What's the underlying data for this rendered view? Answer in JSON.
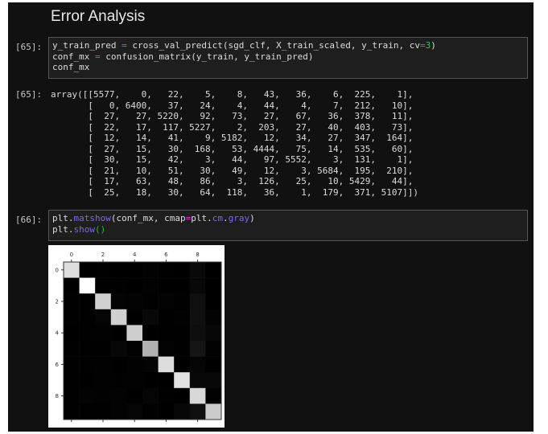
{
  "title": "Error Analysis",
  "cells": [
    {
      "prompt": "[65]:",
      "code": [
        [
          [
            "y_train_pred ",
            ""
          ],
          [
            "=",
            "op"
          ],
          [
            " cross_val_predict(sgd_clf, X_train_scaled, y_train, cv",
            ""
          ],
          [
            "=",
            "op"
          ],
          [
            "3",
            "num"
          ],
          [
            ")",
            ""
          ]
        ],
        [
          [
            "conf_mx ",
            ""
          ],
          [
            "=",
            "op"
          ],
          [
            " confusion_matrix(y_train, y_train_pred)",
            ""
          ]
        ],
        [
          [
            "conf_mx",
            ""
          ]
        ]
      ]
    },
    {
      "prompt": "[66]:",
      "code": [
        [
          [
            "plt.",
            ""
          ],
          [
            "matshow",
            "fn"
          ],
          [
            "(conf_mx, cmap",
            ""
          ],
          [
            "=",
            "op"
          ],
          [
            "plt.",
            ""
          ],
          [
            "cm",
            "fn"
          ],
          [
            ".",
            ""
          ],
          [
            "gray",
            "fn"
          ],
          [
            ")",
            ""
          ]
        ],
        [
          [
            "plt.",
            ""
          ],
          [
            "show",
            "fn"
          ],
          [
            "()",
            "paren"
          ]
        ]
      ]
    }
  ],
  "output_prompt": "[65]:",
  "output_lines": [
    "array([[5577,    0,   22,    5,    8,   43,   36,    6,  225,    1],",
    "       [   0, 6400,   37,   24,    4,   44,    4,    7,  212,   10],",
    "       [  27,   27, 5220,   92,   73,   27,   67,   36,  378,   11],",
    "       [  22,   17,  117, 5227,    2,  203,   27,   40,  403,   73],",
    "       [  12,   14,   41,    9, 5182,   12,   34,   27,  347,  164],",
    "       [  27,   15,   30,  168,   53, 4444,   75,   14,  535,   60],",
    "       [  30,   15,   42,    3,   44,   97, 5552,    3,  131,    1],",
    "       [  21,   10,   51,   30,   49,   12,    3, 5684,  195,  210],",
    "       [  17,   63,   48,   86,    3,  126,   25,   10, 5429,   44],",
    "       [  25,   18,   30,   64,  118,   36,    1,  179,  371, 5107]])"
  ],
  "chart_data": {
    "type": "heatmap",
    "cmap": "gray",
    "xticks": [
      "0",
      "2",
      "4",
      "6",
      "8"
    ],
    "yticks": [
      "0",
      "2",
      "4",
      "6",
      "8"
    ],
    "matrix": [
      [
        5577,
        0,
        22,
        5,
        8,
        43,
        36,
        6,
        225,
        1
      ],
      [
        0,
        6400,
        37,
        24,
        4,
        44,
        4,
        7,
        212,
        10
      ],
      [
        27,
        27,
        5220,
        92,
        73,
        27,
        67,
        36,
        378,
        11
      ],
      [
        22,
        17,
        117,
        5227,
        2,
        203,
        27,
        40,
        403,
        73
      ],
      [
        12,
        14,
        41,
        9,
        5182,
        12,
        34,
        27,
        347,
        164
      ],
      [
        27,
        15,
        30,
        168,
        53,
        4444,
        75,
        14,
        535,
        60
      ],
      [
        30,
        15,
        42,
        3,
        44,
        97,
        5552,
        3,
        131,
        1
      ],
      [
        21,
        10,
        51,
        30,
        49,
        12,
        3,
        5684,
        195,
        210
      ],
      [
        17,
        63,
        48,
        86,
        3,
        126,
        25,
        10,
        5429,
        44
      ],
      [
        25,
        18,
        30,
        64,
        118,
        36,
        1,
        179,
        371,
        5107
      ]
    ]
  }
}
